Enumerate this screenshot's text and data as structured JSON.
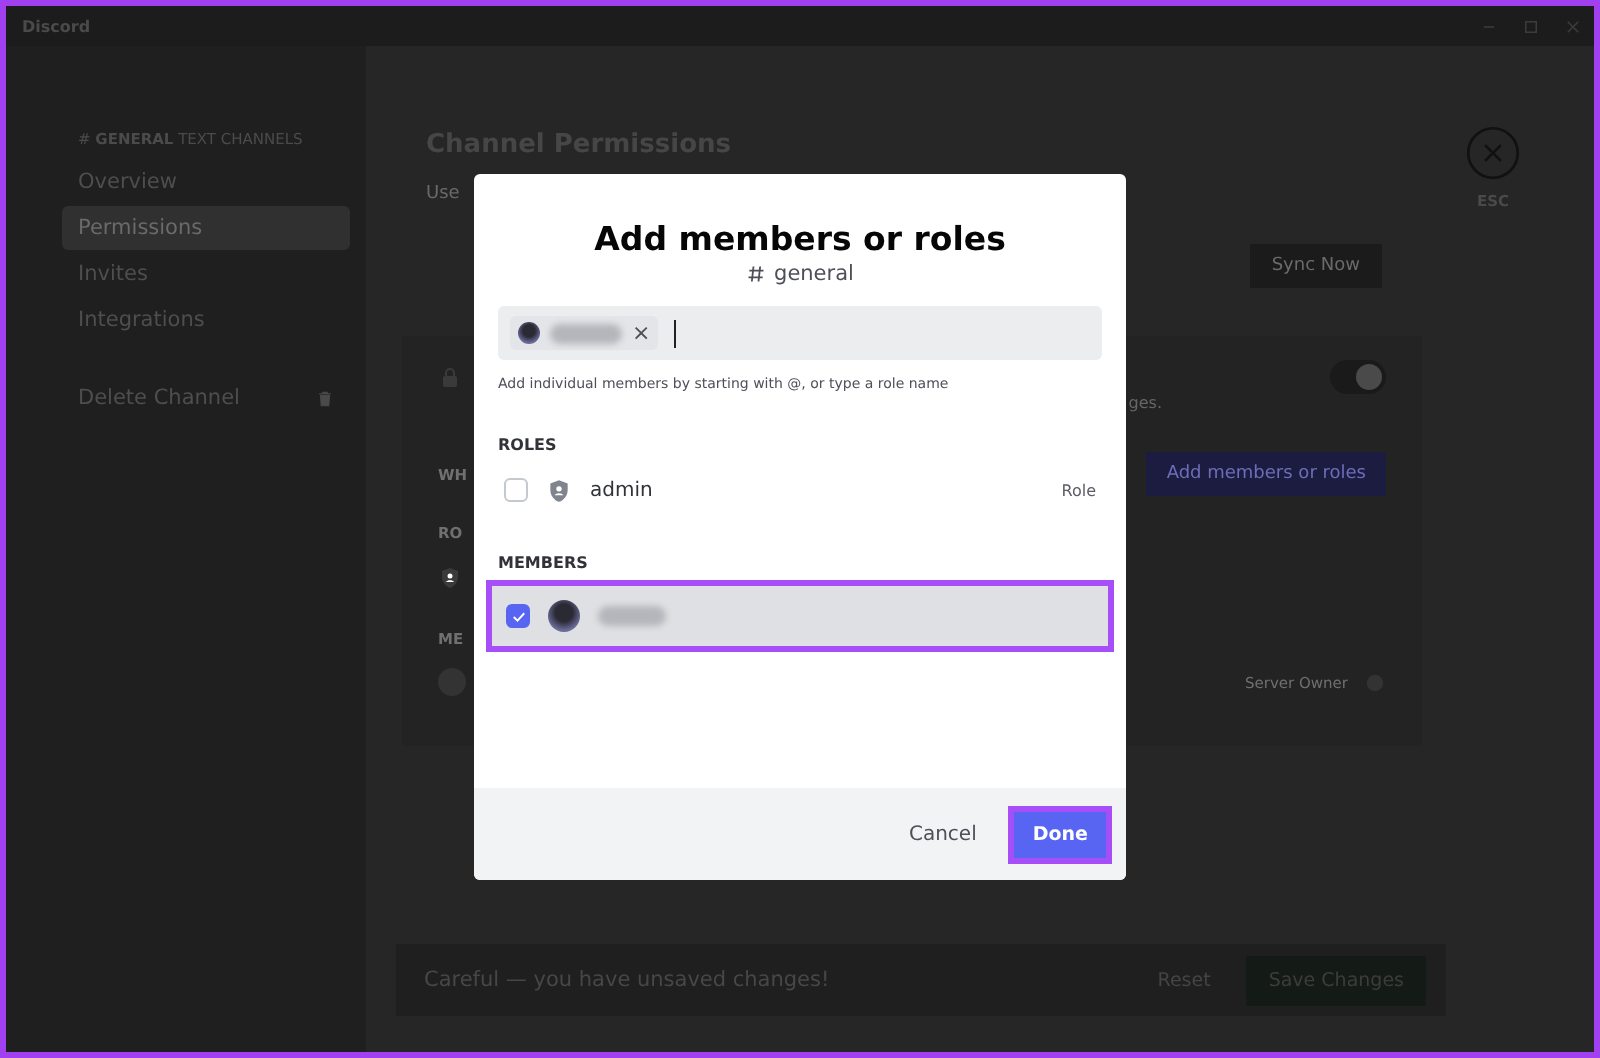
{
  "window": {
    "title": "Discord"
  },
  "sidebar": {
    "header": "# **GENERAL** TEXT CHANNELS",
    "items": [
      {
        "label": "Overview",
        "kind": "link",
        "selected": false
      },
      {
        "label": "Permissions",
        "kind": "link",
        "selected": true
      },
      {
        "label": "Invites",
        "kind": "link",
        "selected": false
      },
      {
        "label": "Integrations",
        "kind": "link",
        "selected": false
      },
      {
        "label": "Delete Channel",
        "kind": "danger",
        "selected": false
      }
    ]
  },
  "main": {
    "title": "Channel Permissions",
    "intro": "Use",
    "sync_button": "Sync Now",
    "card": {
      "toggle_on": true,
      "note": "ges.",
      "label_1": "WH",
      "add_button": "Add members or roles",
      "label_2": "RO",
      "label_3": "ME",
      "owner_label": "Server Owner"
    }
  },
  "close": {
    "label": "ESC"
  },
  "unsaved_bar": {
    "message": "Careful — you have unsaved changes!",
    "reset": "Reset",
    "save": "Save Changes"
  },
  "dialog": {
    "title": "Add members or roles",
    "channel": "general",
    "input": {
      "chip_remove": "×",
      "hint": "Add individual members by starting with @, or type a role name"
    },
    "sections": [
      {
        "heading": "ROLES",
        "items": [
          {
            "kind": "role",
            "name": "admin",
            "tag": "Role",
            "checked": false,
            "selected": false
          }
        ]
      },
      {
        "heading": "MEMBERS",
        "items": [
          {
            "kind": "member",
            "checked": true,
            "selected": true
          }
        ]
      }
    ],
    "cancel": "Cancel",
    "done": "Done"
  }
}
